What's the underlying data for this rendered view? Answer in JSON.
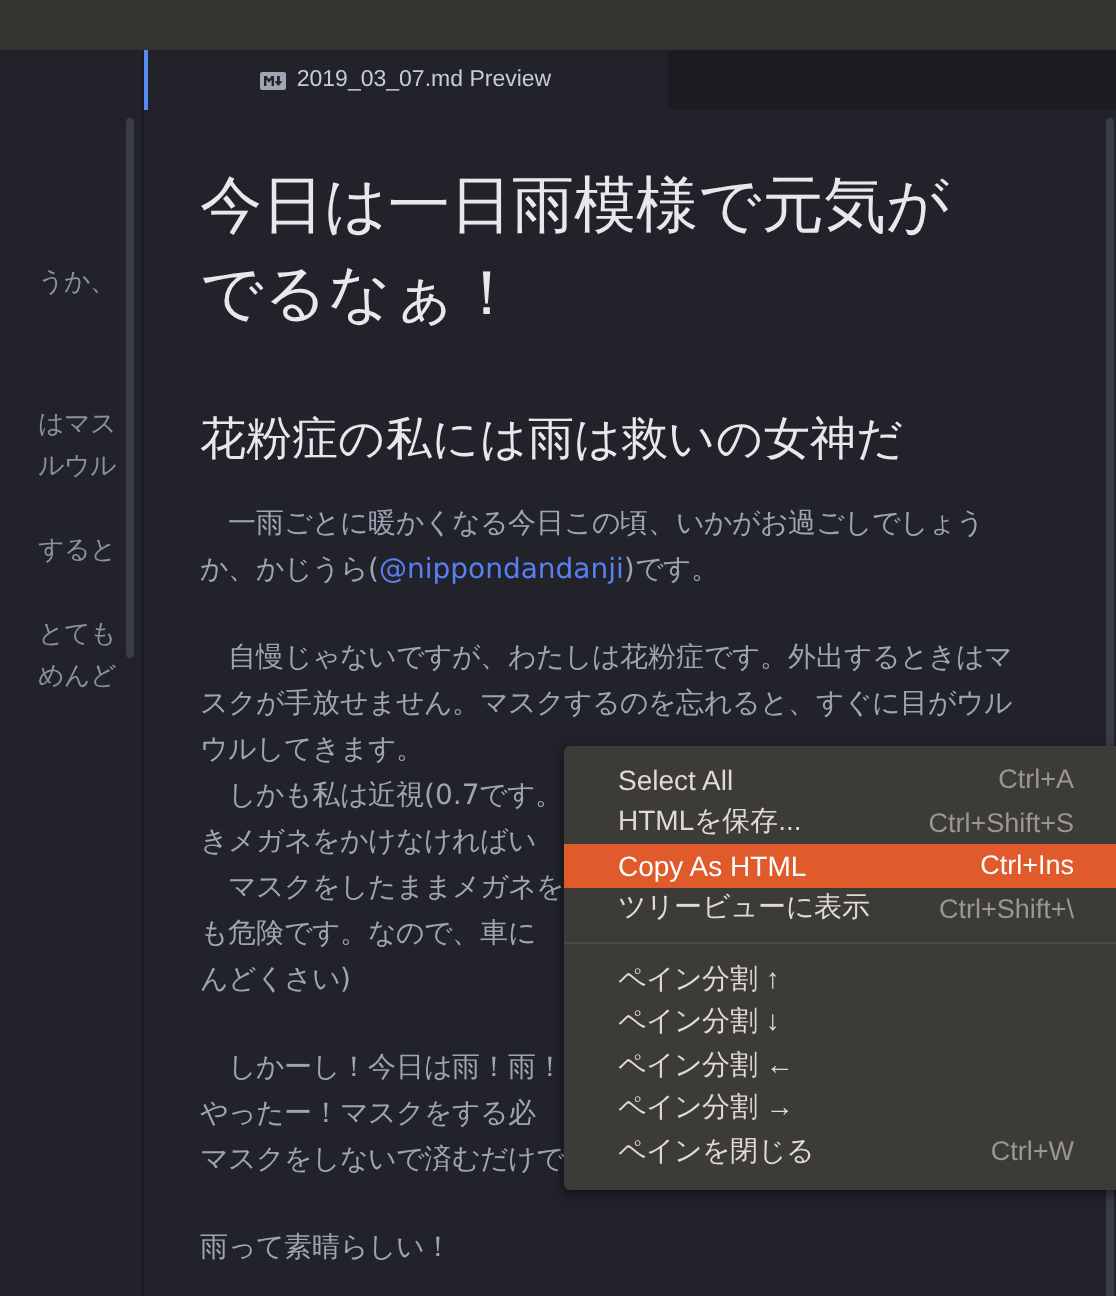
{
  "side_pane": {
    "paragraphs": [
      [
        "うか、"
      ],
      [
        "はマス",
        "ルウル"
      ],
      [
        "すると"
      ],
      [
        "とても",
        "めんど"
      ]
    ]
  },
  "tab": {
    "label": "2019_03_07.md Preview",
    "selected": true
  },
  "preview": {
    "title": "今日は一日雨模様で元気がでるなぁ！",
    "subtitle": "花粉症の私には雨は救いの女神だ",
    "paragraphs": [
      {
        "lines": [
          {
            "text": "　一雨ごとに暖かくなる今日この頃、いかがお過ごしでしょう"
          },
          {
            "text": "か、かじうら(",
            "link": "@nippondandanji",
            "after": ")です。"
          }
        ]
      },
      {
        "lines": [
          {
            "text": "　自慢じゃないですが、わたしは花粉症です。外出するときはマ"
          },
          {
            "text": "スクが手放せません。マスクするのを忘れると、すぐに目がウル"
          },
          {
            "text": "ウルしてきます。"
          },
          {
            "text": "　しかも私は近視(0.7です。"
          },
          {
            "text": "きメガネをかけなければい"
          },
          {
            "text": "　マスクをしたままメガネを"
          },
          {
            "text": "も危険です。なので、車に"
          },
          {
            "text": "んどくさい)"
          }
        ]
      },
      {
        "lines": [
          {
            "text": "　しかーし！今日は雨！雨！"
          },
          {
            "text": "やったー！マスクをする必"
          },
          {
            "text": "マスクをしないで済むだけで"
          }
        ]
      },
      {
        "lines": [
          {
            "text": "雨って素晴らしい！"
          }
        ]
      }
    ]
  },
  "context_menu": {
    "items": [
      {
        "kind": "item",
        "label": "Select All",
        "shortcut": "Ctrl+A",
        "selected": false
      },
      {
        "kind": "item",
        "label": "HTMLを保存...",
        "shortcut": "Ctrl+Shift+S",
        "selected": false
      },
      {
        "kind": "item",
        "label": "Copy As HTML",
        "shortcut": "Ctrl+Ins",
        "selected": true
      },
      {
        "kind": "item",
        "label": "ツリービューに表示",
        "shortcut": "Ctrl+Shift+\\",
        "selected": false
      },
      {
        "kind": "separator"
      },
      {
        "kind": "item",
        "label": "ペイン分割 ↑",
        "selected": false
      },
      {
        "kind": "item",
        "label": "ペイン分割 ↓",
        "selected": false
      },
      {
        "kind": "item",
        "label": "ペイン分割 ←",
        "selected": false
      },
      {
        "kind": "item",
        "label": "ペイン分割 →",
        "selected": false
      },
      {
        "kind": "item",
        "label": "ペインを閉じる",
        "shortcut": "Ctrl+W",
        "selected": false
      }
    ]
  }
}
